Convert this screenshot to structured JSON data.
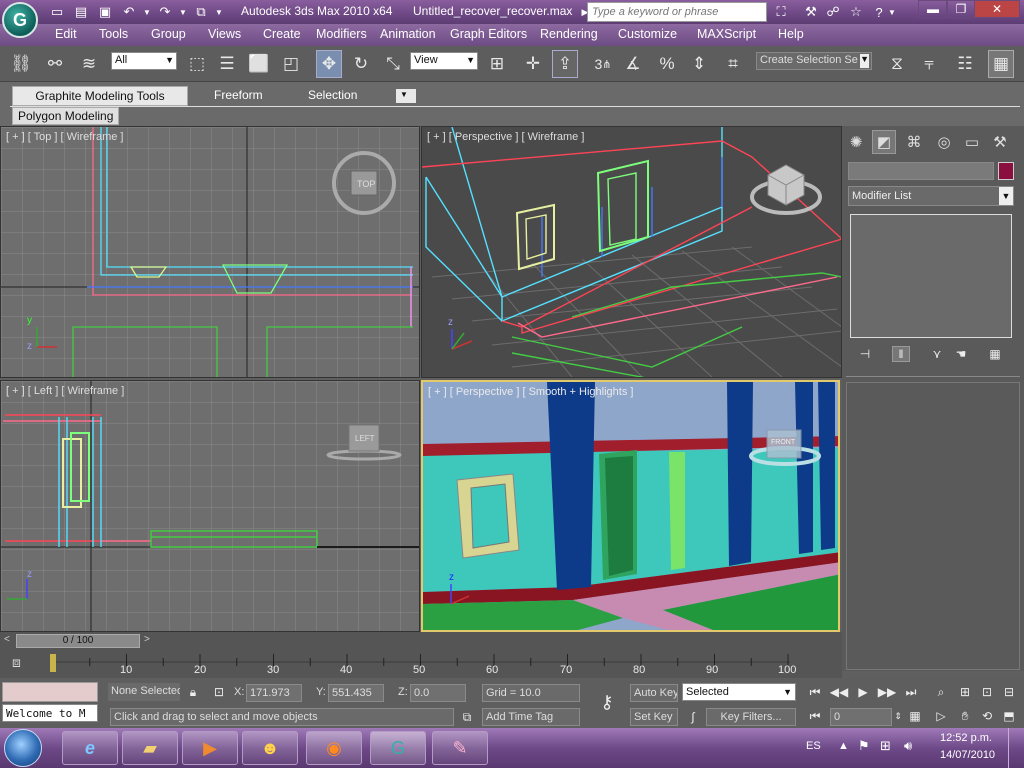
{
  "window": {
    "app_title": "Autodesk 3ds Max  2010 x64",
    "file_title": "Untitled_recover_recover.max",
    "search_placeholder": "Type a keyword or phrase"
  },
  "menu": [
    "Edit",
    "Tools",
    "Group",
    "Views",
    "Create",
    "Modifiers",
    "Animation",
    "Graph Editors",
    "Rendering",
    "Customize",
    "MAXScript",
    "Help"
  ],
  "toolbar": {
    "selection_filter": "All",
    "reference_coord": "View",
    "named_selection_placeholder": "Create Selection Se",
    "snap_label": "3"
  },
  "ribbon": {
    "tabs": [
      "Graphite Modeling Tools",
      "Freeform",
      "Selection"
    ],
    "active_tab": "Graphite Modeling Tools",
    "panel_label": "Polygon Modeling"
  },
  "viewports": {
    "top_left": "[ + ] [ Top ] [ Wireframe ]",
    "top_right": "[ + ] [ Perspective ] [ Wireframe ]",
    "bottom_left": "[ + ] [ Left ] [ Wireframe ]",
    "bottom_right": "[ + ] [ Perspective ] [ Smooth + Highlights ]",
    "viewcube_top": "TOP",
    "viewcube_left": "LEFT",
    "viewcube_front": "FRONT",
    "axis_x": "x",
    "axis_y": "y",
    "axis_z": "z"
  },
  "command_panel": {
    "modifier_list": "Modifier List",
    "object_color": "#8a0f3f"
  },
  "timeline": {
    "frame_display": "0 / 100",
    "ticks": [
      "0",
      "10",
      "20",
      "30",
      "40",
      "50",
      "60",
      "70",
      "80",
      "90",
      "100"
    ]
  },
  "status": {
    "selection": "None Selected",
    "x_label": "X:",
    "x_value": "171.973",
    "y_label": "Y:",
    "y_value": "551.435",
    "z_label": "Z:",
    "z_value": "0.0",
    "grid": "Grid = 10.0",
    "auto_key": "Auto Key",
    "set_key": "Set Key",
    "key_mode": "Selected",
    "key_filters": "Key Filters...",
    "add_time_tag": "Add Time Tag",
    "prompt": "Click and drag to select and move objects",
    "maxscript_listener": "Welcome to M",
    "current_frame": "0"
  },
  "taskbar": {
    "language": "ES",
    "time": "12:52 p.m.",
    "date": "14/07/2010"
  }
}
